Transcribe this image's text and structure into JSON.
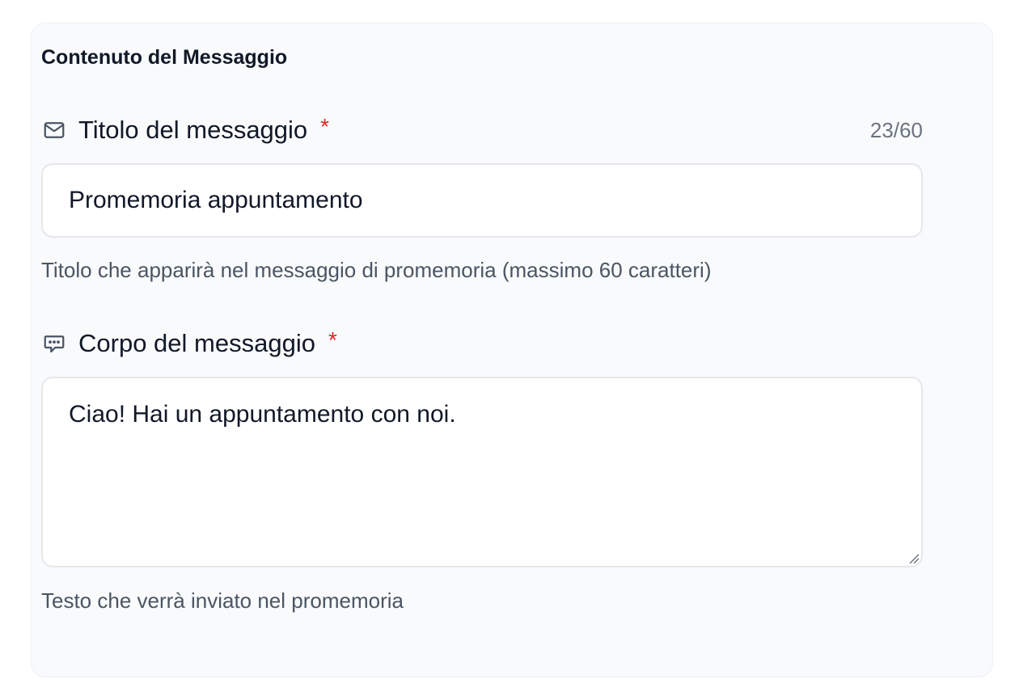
{
  "section": {
    "title": "Contenuto del Messaggio"
  },
  "title_field": {
    "icon": "mail-icon",
    "label": "Titolo del messaggio",
    "required_mark": "*",
    "counter": "23/60",
    "value": "Promemoria appuntamento",
    "help": "Titolo che apparirà nel messaggio di promemoria (massimo 60 caratteri)"
  },
  "body_field": {
    "icon": "chat-bubble-icon",
    "label": "Corpo del messaggio",
    "required_mark": "*",
    "value": "Ciao! Hai un appuntamento con noi.",
    "help": "Testo che verrà inviato nel promemoria"
  },
  "colors": {
    "card_background": "#f8fafc",
    "required": "#dc2626",
    "text_primary": "#111827",
    "text_muted": "#4b5563"
  }
}
